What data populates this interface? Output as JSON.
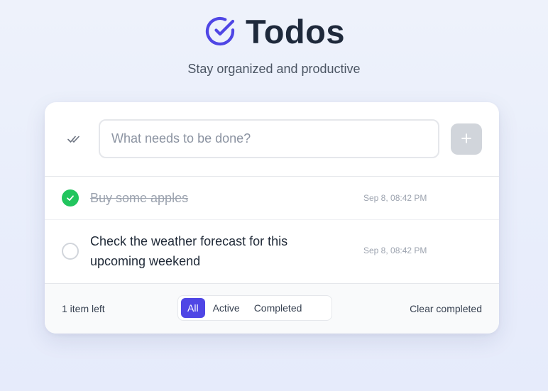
{
  "app": {
    "title": "Todos",
    "subtitle": "Stay organized and productive",
    "logo_icon": "check-circle-icon",
    "accent_color": "#4f46e5"
  },
  "input": {
    "placeholder": "What needs to be done?",
    "value": "",
    "toggle_all_icon": "double-check-icon",
    "add_icon": "plus-icon"
  },
  "todos": [
    {
      "text": "Buy some apples",
      "time": "Sep 8, 08:42 PM",
      "completed": true
    },
    {
      "text": "Check the weather forecast for this upcoming weekend",
      "time": "Sep 8, 08:42 PM",
      "completed": false
    }
  ],
  "footer": {
    "items_left": "1 item left",
    "filters": [
      "All",
      "Active",
      "Completed"
    ],
    "active_filter": "All",
    "clear_label": "Clear completed"
  },
  "colors": {
    "completed_check": "#22c55e",
    "add_button": "#d1d5db",
    "background": "#eef2fb"
  }
}
